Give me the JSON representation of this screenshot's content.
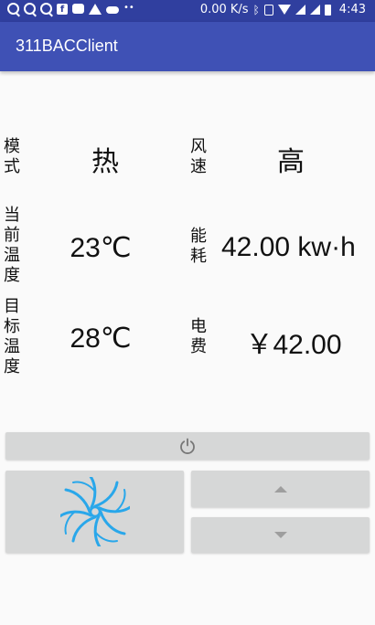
{
  "status_bar": {
    "speed": "0.00 K/s",
    "time": "4:43",
    "left_icons": [
      "q-icon",
      "q-icon",
      "q-icon",
      "facebook-icon",
      "wechat-icon",
      "alert-icon",
      "cloud-icon",
      "more-dots-icon"
    ],
    "right_icons": [
      "bluetooth-icon",
      "nfc-icon",
      "wifi-icon",
      "signal-icon",
      "signal-icon",
      "battery-icon"
    ]
  },
  "app_bar": {
    "title": "311BACClient",
    "color": "#3f51b5",
    "status_color": "#303f9f"
  },
  "labels": {
    "mode": "模式",
    "wind_speed": "风速",
    "current_temp": "当前温度",
    "energy": "能耗",
    "target_temp": "目标温度",
    "fee": "电费"
  },
  "values": {
    "mode": "热",
    "wind_speed": "高",
    "current_temp": "23℃",
    "energy": "42.00  kw·h",
    "target_temp": "28℃",
    "fee": "￥42.00"
  },
  "controls": {
    "power_icon": "power-icon",
    "fan_icon": "fan-icon",
    "up_icon": "arrow-up-icon",
    "down_icon": "arrow-down-icon",
    "button_color": "#d6d7d7",
    "fan_color": "#29a7ea"
  }
}
